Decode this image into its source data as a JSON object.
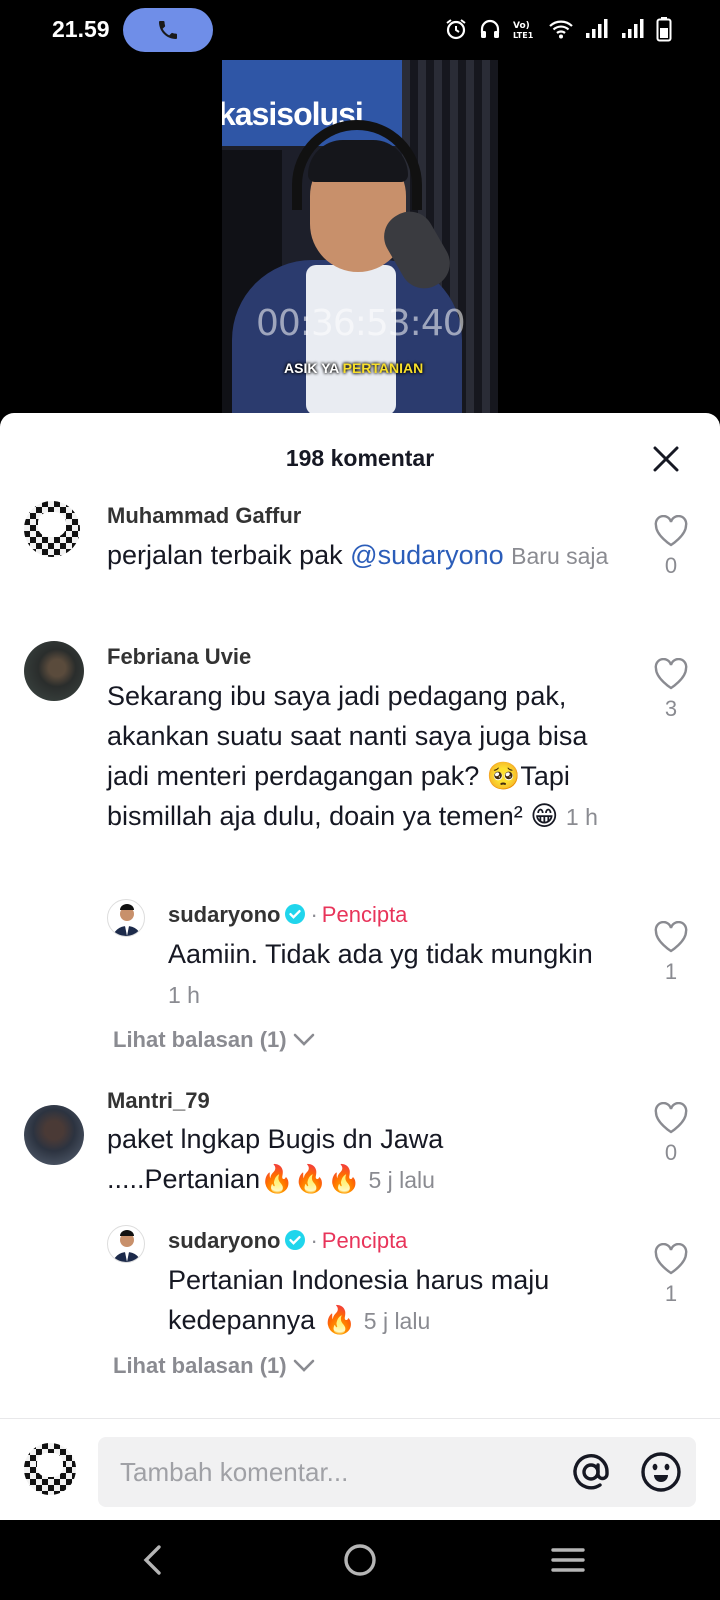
{
  "status_bar": {
    "time": "21.59"
  },
  "video": {
    "banner_text": "kasisolusi",
    "timer": "00:36:53:40",
    "caption_prefix": "ASIK YA",
    "caption_highlight": "PERTANIAN"
  },
  "sheet": {
    "title": "198 komentar"
  },
  "comments": [
    {
      "username": "Muhammad Gaffur",
      "text": "perjalan terbaik pak ",
      "mention": "@sudaryono",
      "time": "Baru saja",
      "likes": "0"
    },
    {
      "username": "Febriana Uvie",
      "text": "Sekarang ibu saya jadi pedagang pak, akankan suatu saat nanti saya juga bisa jadi menteri perdagangan pak? 🥺Tapi bismillah aja dulu, doain ya temen² 😁",
      "time": "1 h",
      "likes": "3",
      "reply": {
        "username": "sudaryono",
        "separator": "·",
        "badge": "Pencipta",
        "text": "Aamiin. Tidak ada yg tidak mungkin",
        "time": "1 h",
        "likes": "1"
      },
      "view_replies": "Lihat balasan (1)"
    },
    {
      "username": "Mantri_79",
      "text": "paket lngkap Bugis dn Jawa .....Pertanian🔥🔥🔥",
      "time": "5 j lalu",
      "likes": "0",
      "reply": {
        "username": "sudaryono",
        "separator": "·",
        "badge": "Pencipta",
        "text": "Pertanian Indonesia harus maju kedepannya 🔥",
        "time": "5 j lalu",
        "likes": "1"
      },
      "view_replies": "Lihat balasan (1)"
    }
  ],
  "input": {
    "placeholder": "Tambah komentar..."
  },
  "colors": {
    "mention": "#2b5db9",
    "creator_badge": "#e8345a",
    "verified": "#20d5ec",
    "call_pill": "#6f8ee8"
  },
  "icons": [
    "phone-icon",
    "alarm-icon",
    "headphones-icon",
    "volte-icon",
    "wifi-icon",
    "signal-icon",
    "battery-icon",
    "close-icon",
    "heart-icon",
    "verified-icon",
    "chevron-down-icon",
    "at-icon",
    "emoji-icon",
    "back-icon",
    "home-icon",
    "recents-icon"
  ]
}
